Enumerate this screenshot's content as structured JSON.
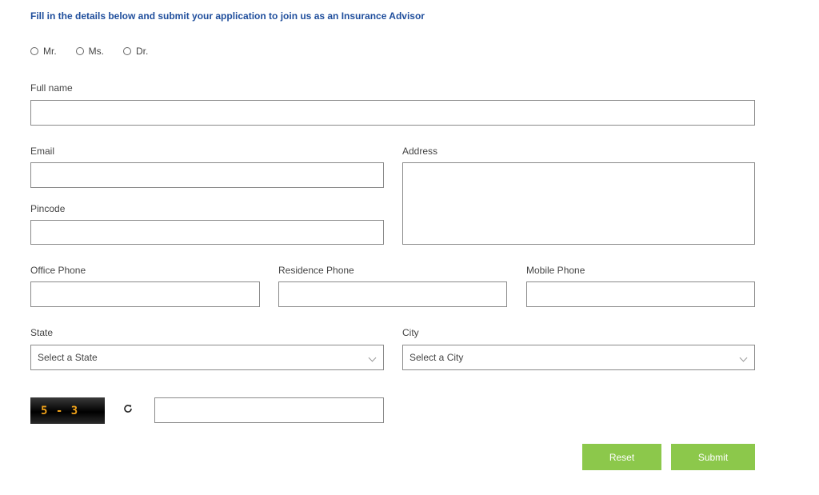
{
  "intro_text": "Fill in the details below and submit your application to join us as an Insurance Advisor",
  "salutations": [
    {
      "label": "Mr."
    },
    {
      "label": "Ms."
    },
    {
      "label": "Dr."
    }
  ],
  "fields": {
    "full_name": {
      "label": "Full name",
      "value": ""
    },
    "email": {
      "label": "Email",
      "value": ""
    },
    "address": {
      "label": "Address",
      "value": ""
    },
    "pincode": {
      "label": "Pincode",
      "value": ""
    },
    "office_phone": {
      "label": "Office Phone",
      "value": ""
    },
    "residence_phone": {
      "label": "Residence Phone",
      "value": ""
    },
    "mobile_phone": {
      "label": "Mobile Phone",
      "value": ""
    },
    "state": {
      "label": "State",
      "selected": "Select a State"
    },
    "city": {
      "label": "City",
      "selected": "Select a City"
    },
    "captcha_answer": {
      "value": ""
    }
  },
  "captcha": {
    "text": "5 - 3"
  },
  "icons": {
    "refresh": "refresh-icon",
    "dropdown": "chevron-down-icon"
  },
  "buttons": {
    "reset": "Reset",
    "submit": "Submit"
  },
  "colors": {
    "accent": "#8cc84b",
    "heading": "#1f4e9c",
    "captcha_text": "#f0a21a"
  }
}
